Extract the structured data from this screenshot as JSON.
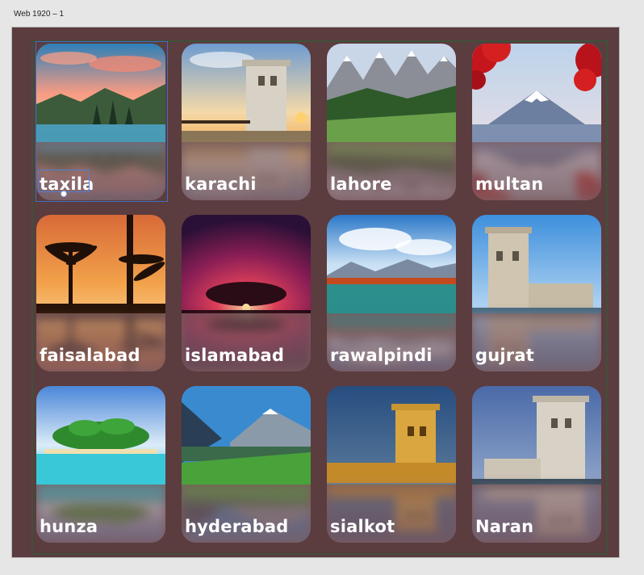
{
  "artboard": {
    "title": "Web 1920 – 1"
  },
  "cards": [
    {
      "label": "taxila",
      "scene": "lake-mountains-sunset"
    },
    {
      "label": "karachi",
      "scene": "stone-tower-pier"
    },
    {
      "label": "lahore",
      "scene": "alpine-peaks-meadow"
    },
    {
      "label": "multan",
      "scene": "mount-fuji-red-maple"
    },
    {
      "label": "faisalabad",
      "scene": "palm-trees-sunset"
    },
    {
      "label": "islamabad",
      "scene": "tree-silhouette-pink-sky"
    },
    {
      "label": "rawalpindi",
      "scene": "lake-reflection-mountains"
    },
    {
      "label": "gujrat",
      "scene": "stone-tower-blue-sky"
    },
    {
      "label": "hunza",
      "scene": "tropical-island-beach"
    },
    {
      "label": "hyderabad",
      "scene": "mountain-valley-lake"
    },
    {
      "label": "sialkot",
      "scene": "tower-night-lights"
    },
    {
      "label": "Naran",
      "scene": "stone-tower-evening"
    }
  ],
  "colors": {
    "canvas": "#e6e6e6",
    "artboard": "#5b3c3f",
    "card": "#7b5a5e",
    "label": "#ffffff",
    "selection": "#3d6fc4"
  }
}
